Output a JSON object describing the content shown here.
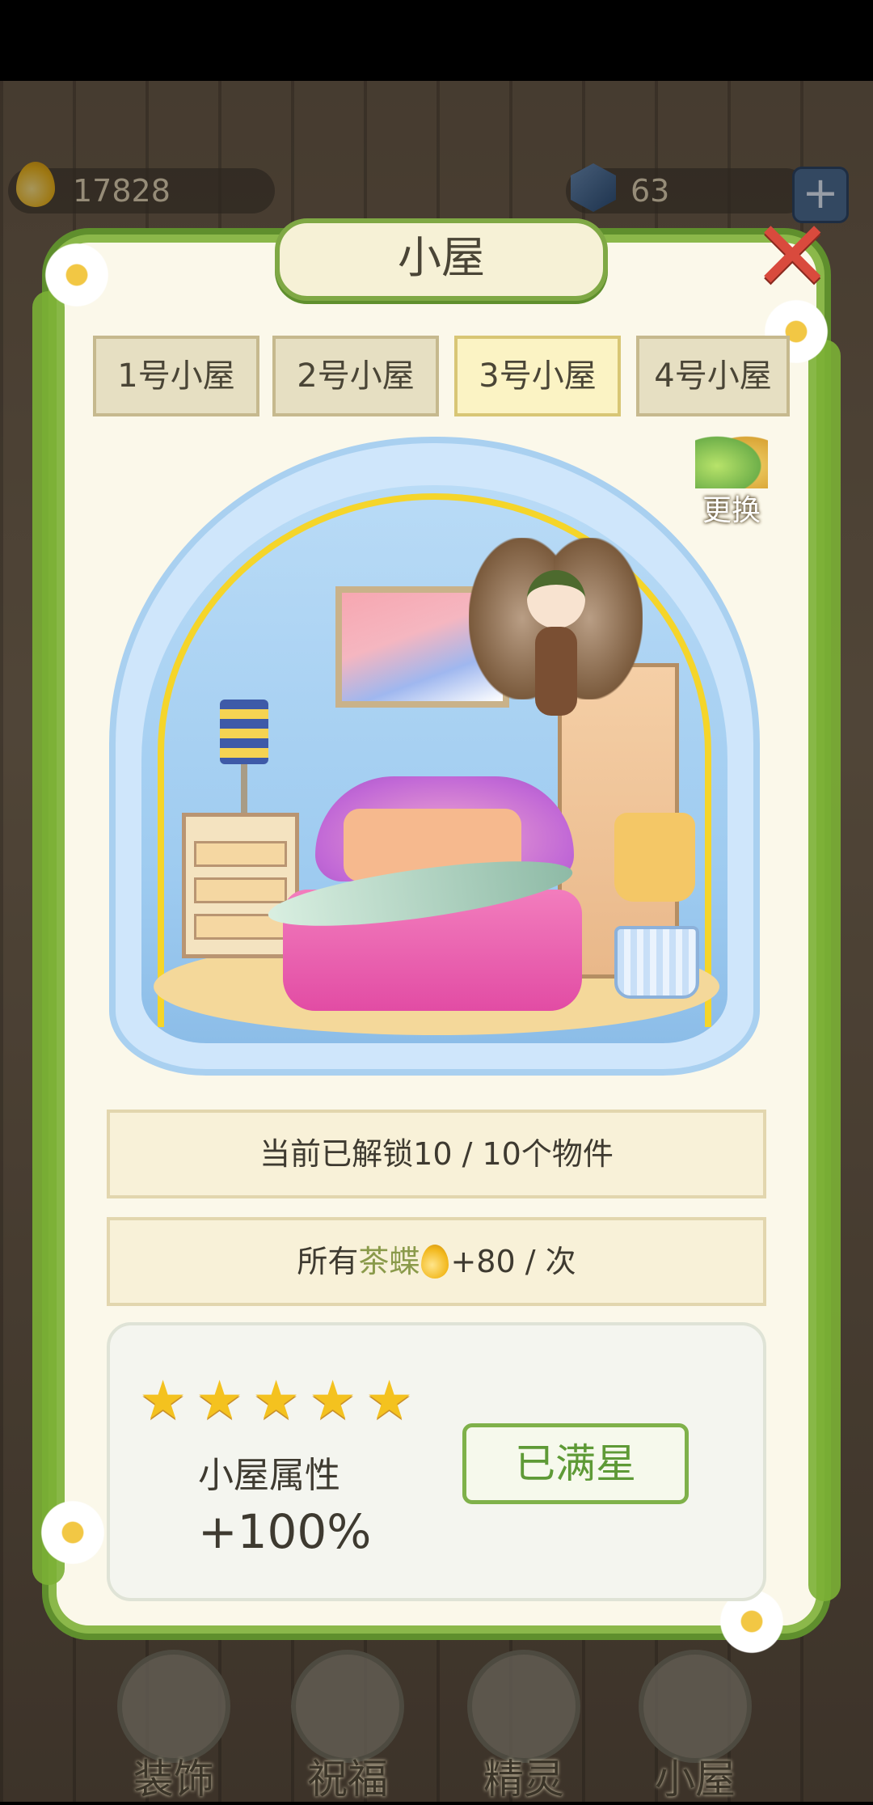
{
  "hud": {
    "drops_value": "17828",
    "gems_value": "63",
    "add_label": "+"
  },
  "dialog": {
    "title": "小屋",
    "close_label": "✕",
    "tabs": [
      {
        "label": "1号小屋",
        "active": false
      },
      {
        "label": "2号小屋",
        "active": false
      },
      {
        "label": "3号小屋",
        "active": true
      },
      {
        "label": "4号小屋",
        "active": false
      }
    ],
    "swap_label": "更换",
    "unlocked_text": "当前已解锁10 / 10个物件",
    "bonus_prefix": "所有",
    "bonus_highlight": "茶蝶",
    "bonus_suffix": "+80 / 次",
    "stars": {
      "filled": 5,
      "total": 5
    },
    "attr_label": "小屋属性",
    "attr_value": "+100%",
    "maxed_label": "已满星"
  },
  "bottom_nav": [
    {
      "label": "装饰",
      "icon": "plant-icon"
    },
    {
      "label": "祝福",
      "icon": "blessing-icon"
    },
    {
      "label": "精灵",
      "icon": "fairy-icon"
    },
    {
      "label": "小屋",
      "icon": "house-icon"
    }
  ],
  "colors": {
    "accent_green": "#7fb14a",
    "panel_bg": "#fbf8ea",
    "star_gold": "#f4c21f",
    "close_red": "#d94a3d"
  }
}
